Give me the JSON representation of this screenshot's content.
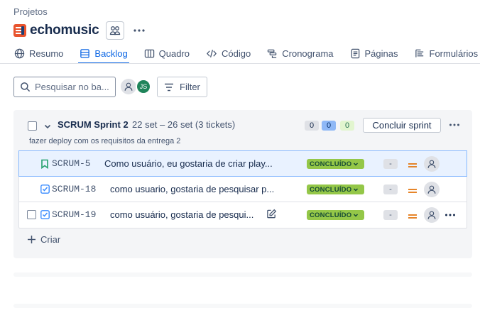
{
  "breadcrumb": "Projetos",
  "project": {
    "name": "echomusic",
    "brand_color": "#e8542e"
  },
  "tabs": [
    {
      "label": "Resumo",
      "icon": "globe-icon"
    },
    {
      "label": "Backlog",
      "icon": "backlog-icon",
      "active": true
    },
    {
      "label": "Quadro",
      "icon": "board-icon"
    },
    {
      "label": "Código",
      "icon": "code-icon"
    },
    {
      "label": "Cronograma",
      "icon": "timeline-icon"
    },
    {
      "label": "Páginas",
      "icon": "pages-icon"
    },
    {
      "label": "Formulários",
      "icon": "forms-icon"
    }
  ],
  "search": {
    "placeholder": "Pesquisar no ba..."
  },
  "avatars": {
    "js_initials": "JS"
  },
  "filter": {
    "label": "Filter"
  },
  "sprint": {
    "name": "SCRUM Sprint 2",
    "dates": "22 set – 26 set (3 tickets)",
    "goal": "fazer deploy com os requisitos da entrega 2",
    "counts": {
      "todo": "0",
      "in_progress": "0",
      "done": "0"
    },
    "complete_label": "Concluir sprint"
  },
  "issues": [
    {
      "key": "SCRUM-5",
      "summary": "Como usuário, eu gostaria de criar play...",
      "type": "story-icon",
      "status": "CONCLUÍDO",
      "estimate": "-",
      "priority": "medium"
    },
    {
      "key": "SCRUM-18",
      "summary": "como usuario, gostaria de pesquisar p...",
      "type": "task-icon",
      "status": "CONCLUÍDO",
      "estimate": "-",
      "priority": "medium"
    },
    {
      "key": "SCRUM-19",
      "summary": "como usuário, gostaria de pesqui...",
      "type": "task-icon",
      "status": "CONCLUÍDO",
      "estimate": "-",
      "priority": "medium"
    }
  ],
  "create_label": "Criar",
  "colors": {
    "accent": "#0c66e4",
    "done_lozenge": "#94c748",
    "priority_medium": "#e2740d"
  }
}
